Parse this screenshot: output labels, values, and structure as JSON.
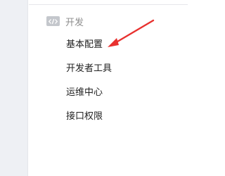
{
  "sidebar": {
    "section": {
      "title": "开发",
      "icon": "code-icon"
    },
    "items": [
      {
        "label": "基本配置"
      },
      {
        "label": "开发者工具"
      },
      {
        "label": "运维中心"
      },
      {
        "label": "接口权限"
      }
    ]
  },
  "annotation": {
    "type": "arrow",
    "color": "#e8312f"
  }
}
